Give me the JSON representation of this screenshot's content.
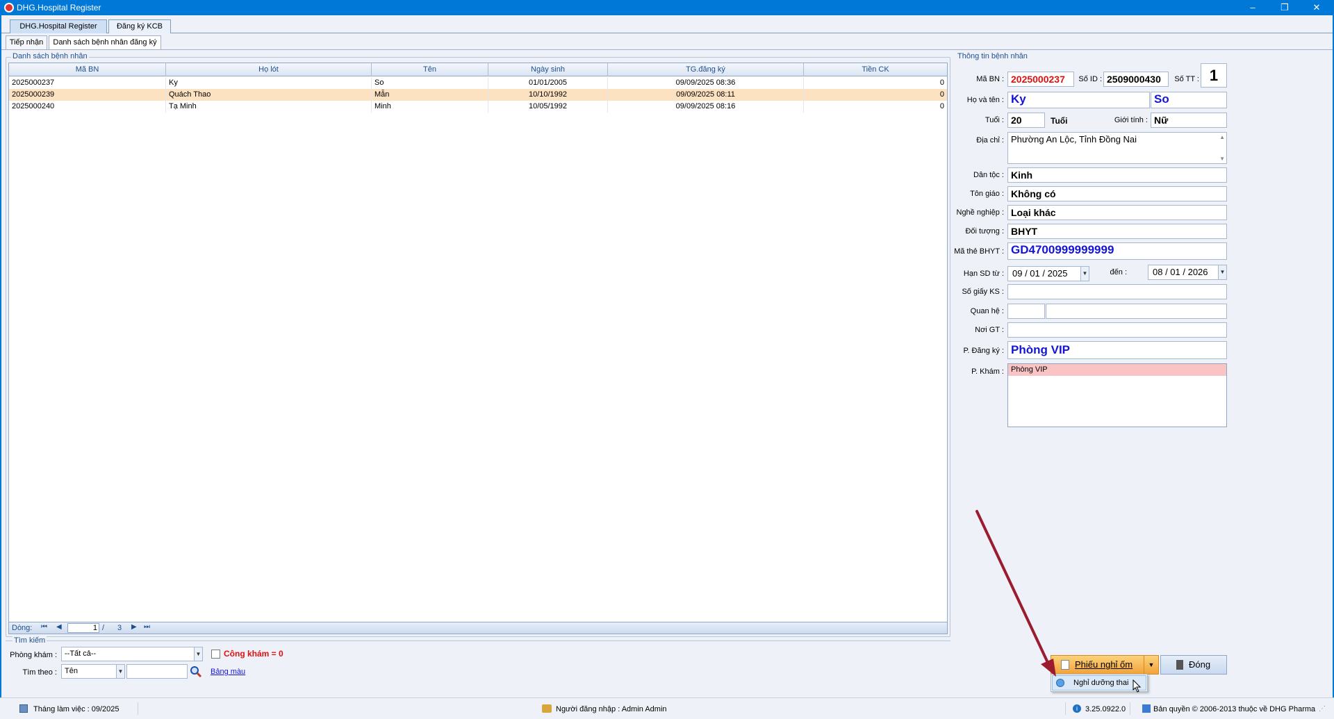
{
  "window": {
    "title": "DHG.Hospital Register",
    "minimize": "–",
    "restore": "❐",
    "close": "✕"
  },
  "tabs": [
    "DHG.Hospital Register",
    "Đăng ký KCB"
  ],
  "subtabs": [
    "Tiếp nhận",
    "Danh sách bệnh nhân đăng ký"
  ],
  "patient_list": {
    "group_label": "Danh sách bệnh nhân",
    "columns": [
      "Mã BN",
      "Họ lót",
      "Tên",
      "Ngày sinh",
      "TG.đăng ký",
      "Tiền CK"
    ],
    "rows": [
      [
        "2025000237",
        "Ky",
        "So",
        "01/01/2005",
        "09/09/2025 08:36",
        "0"
      ],
      [
        "2025000239",
        "Quách Thao",
        "Mẫn",
        "10/10/1992",
        "09/09/2025 08:11",
        "0"
      ],
      [
        "2025000240",
        "Tạ Minh",
        "Minh",
        "10/05/1992",
        "09/09/2025 08:16",
        "0"
      ]
    ],
    "nav": {
      "label": "Dòng:",
      "current": "1",
      "separator": "/",
      "total": "3"
    }
  },
  "search": {
    "group_label": "Tìm kiếm",
    "clinic_label": "Phòng khám :",
    "clinic_value": "--Tất cả--",
    "cong_kham_label": "Công khám = 0",
    "search_by_label": "Tìm theo :",
    "search_by_value": "Tên",
    "search_text": "",
    "color_table_link": "Bảng màu"
  },
  "patient_info": {
    "group_label": "Thông tin bệnh nhân",
    "ma_bn_label": "Mã BN :",
    "ma_bn": "2025000237",
    "so_id_label": "Số ID :",
    "so_id": "2509000430",
    "so_tt_label": "Số TT :",
    "so_tt": "1",
    "name_label": "Họ và tên :",
    "ho_lot": "Ky",
    "ten": "So",
    "age_label": "Tuổi :",
    "age": "20",
    "age_unit": "Tuổi",
    "gender_label": "Giới tính :",
    "gender": "Nữ",
    "address_label": "Địa chỉ :",
    "address": "Phường An Lộc, Tỉnh Đồng Nai",
    "ethnic_label": "Dân tộc :",
    "ethnic": "Kinh",
    "religion_label": "Tôn giáo :",
    "religion": "Không có",
    "job_label": "Nghề nghiệp :",
    "job": "Loại khác",
    "object_label": "Đối tượng :",
    "object": "BHYT",
    "card_label": "Mã thẻ BHYT :",
    "card": "GD4700999999999",
    "valid_from_label": "Hạn SD từ :",
    "valid_from": "09 / 01 / 2025",
    "valid_to_label": "đến :",
    "valid_to": "08 / 01 / 2026",
    "birth_cert_label": "Số giấy KS :",
    "birth_cert": "",
    "relation_label": "Quan hệ :",
    "relation_code": "",
    "relation_name": "",
    "referral_label": "Nơi GT :",
    "referral": "",
    "reg_room_label": "P. Đăng ký :",
    "reg_room": "Phòng VIP",
    "exam_room_label": "P. Khám :",
    "exam_rooms": [
      "Phòng VIP"
    ]
  },
  "buttons": {
    "sick_leave": "Phiếu nghỉ ốm",
    "close": "Đóng",
    "menu_item": "Nghỉ dưỡng thai"
  },
  "status": {
    "working_month": "Tháng làm việc : 09/2025",
    "user": "Người đăng nhập : Admin Admin",
    "version": "3.25.0922.0",
    "copyright": "Bản quyền © 2006-2013 thuộc về DHG Pharma"
  },
  "colors": {
    "titlebar": "#0078d7",
    "selected_row": "#fde2c2",
    "exam_room_item": "#fbc4c4",
    "button_orange": "#f7b24a",
    "annotation_arrow": "#9b1c2e"
  }
}
